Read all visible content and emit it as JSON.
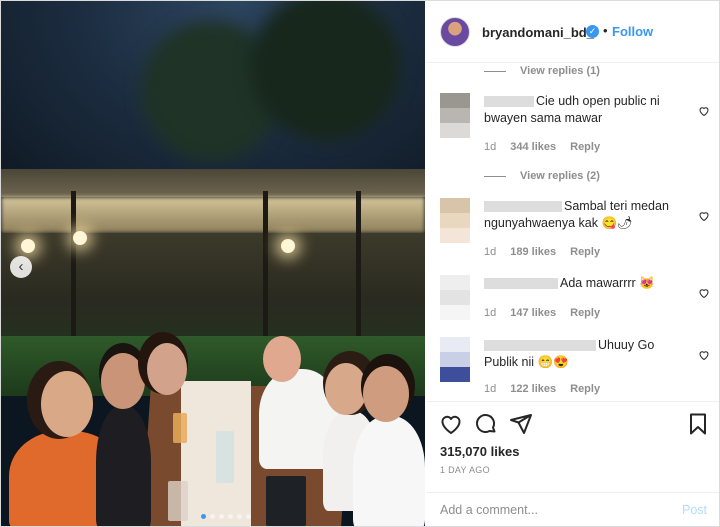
{
  "header": {
    "username": "bryandomani_bd_",
    "separator": "•",
    "follow_label": "Follow"
  },
  "comments": {
    "view_replies_1": "View replies (1)",
    "view_replies_2": "View replies (2)",
    "items": [
      {
        "text": "Cie udh open public ni bwayen sama mawar",
        "time": "1d",
        "likes": "344 likes",
        "reply": "Reply"
      },
      {
        "text": "Sambal teri medan ngunyahwaenya kak 😋🌶",
        "time": "1d",
        "likes": "189 likes",
        "reply": "Reply"
      },
      {
        "text": "Ada mawarrrr 😻",
        "time": "1d",
        "likes": "147 likes",
        "reply": "Reply"
      },
      {
        "text": "Uhuuy Go Publik nii 😁😍",
        "time": "1d",
        "likes": "122 likes",
        "reply": "Reply"
      }
    ]
  },
  "post": {
    "likes": "315,070 likes",
    "time_ago": "1 DAY AGO"
  },
  "comment_box": {
    "placeholder": "Add a comment...",
    "post_label": "Post"
  },
  "carousel": {
    "current": 1,
    "total": 6
  },
  "colors": {
    "link_blue": "#3897f0",
    "muted": "#8e8e8e",
    "post_disabled": "#b3dbff"
  },
  "icons": [
    "verified-badge-icon",
    "more-options-icon",
    "heart-icon",
    "comment-icon",
    "share-icon",
    "bookmark-icon",
    "chevron-left-icon"
  ]
}
